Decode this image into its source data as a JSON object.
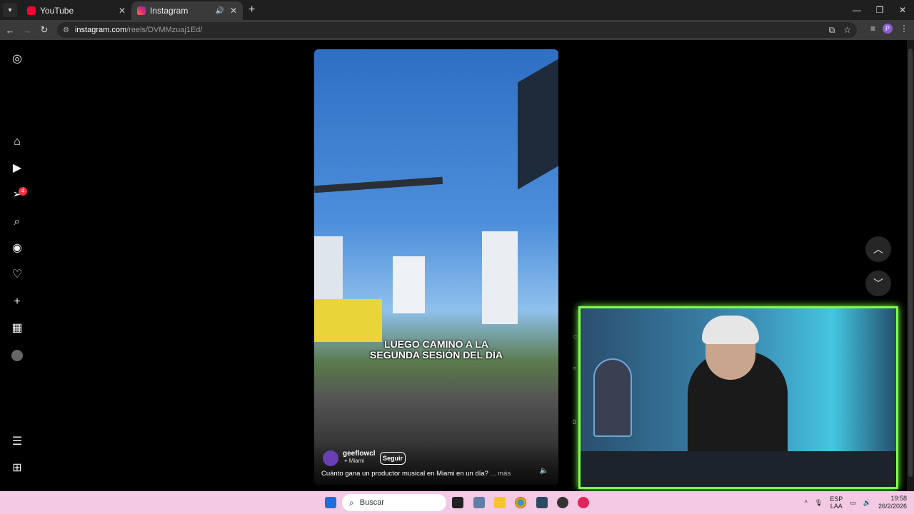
{
  "tabs": [
    {
      "title": "YouTube",
      "active": false
    },
    {
      "title": "Instagram",
      "active": true
    }
  ],
  "address": {
    "host": "instagram.com",
    "path": "/reels/DVMMzuaj1Ed/"
  },
  "sidebar": {
    "notification_count": "4"
  },
  "reel": {
    "caption_lines": [
      "LUEGO CAMINO A LA",
      "SEGUNDA SESIÓN DEL DÍA"
    ],
    "username": "geeflowcl",
    "location": "Miami",
    "follow_label": "Seguir",
    "description": "Cuánto gana un productor musical en Miami en un día?",
    "more_label": "... más"
  },
  "taskbar": {
    "search_placeholder": "Buscar",
    "lang_top": "ESP",
    "lang_bottom": "LAA",
    "time": "19:58",
    "date": "26/2/2026"
  },
  "colors": {
    "accent_green": "#7dff4a",
    "taskbar": "#f3c9e4",
    "badge": "#ff3040"
  }
}
